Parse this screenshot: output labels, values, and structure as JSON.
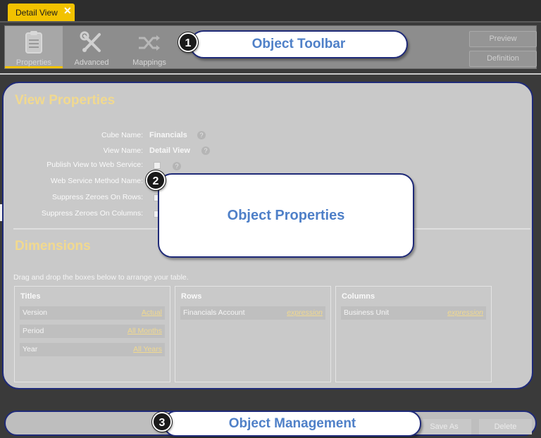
{
  "tab": {
    "label": "Detail View",
    "close_symbol": "✕",
    "accent": "#f2c200"
  },
  "toolbar": {
    "buttons": [
      {
        "label": "Properties",
        "icon": "properties-icon"
      },
      {
        "label": "Advanced",
        "icon": "wrench-screwdriver-icon"
      },
      {
        "label": "Mappings",
        "icon": "shuffle-icon"
      }
    ],
    "preview_label": "Preview",
    "definition_label": "Definition"
  },
  "view_properties": {
    "title": "View Properties",
    "fields": [
      {
        "label": "Cube Name:",
        "value": "Financials"
      },
      {
        "label": "View Name:",
        "value": "Detail View"
      },
      {
        "label": "Publish View to Web Service:"
      },
      {
        "label": "Web Service Method Name:"
      },
      {
        "label": "Suppress Zeroes On Rows:"
      },
      {
        "label": "Suppress Zeroes On Columns:"
      }
    ],
    "help_symbol": "?"
  },
  "dimensions": {
    "title": "Dimensions",
    "hint": "Drag and drop the boxes below to arrange your table.",
    "titles": {
      "header": "Titles",
      "items": [
        {
          "name": "Version",
          "value": "Actual"
        },
        {
          "name": "Period",
          "value": "All Months"
        },
        {
          "name": "Year",
          "value": "All Years"
        }
      ]
    },
    "rows": {
      "header": "Rows",
      "items": [
        {
          "name": "Financials Account",
          "value": "expression"
        }
      ]
    },
    "columns": {
      "header": "Columns",
      "items": [
        {
          "name": "Business Unit",
          "value": "expression"
        }
      ]
    }
  },
  "management": {
    "save_as_label": "Save As",
    "delete_label": "Delete"
  },
  "callouts": [
    {
      "number": "1",
      "text": "Object Toolbar"
    },
    {
      "number": "2",
      "text": "Object Properties"
    },
    {
      "number": "3",
      "text": "Object Management"
    }
  ],
  "colors": {
    "callout_border": "#1f2a78",
    "callout_text": "#4f80c8",
    "section_title": "#f1d98f"
  }
}
